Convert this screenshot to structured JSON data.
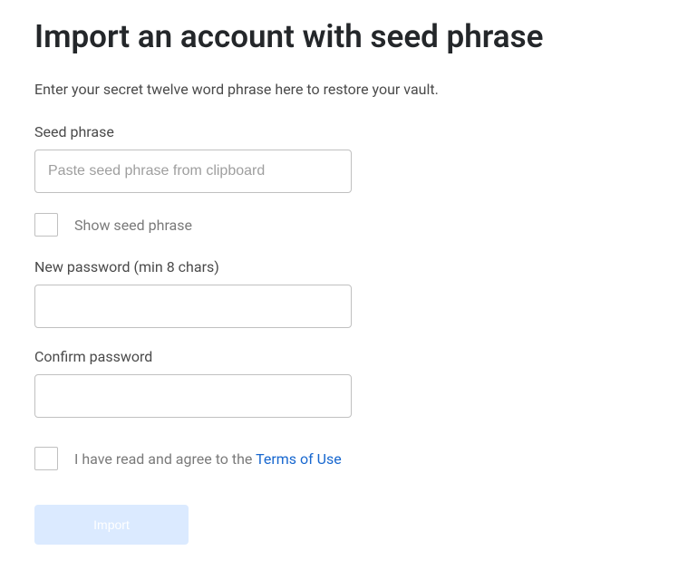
{
  "title": "Import an account with seed phrase",
  "subtitle": "Enter your secret twelve word phrase here to restore your vault.",
  "seed": {
    "label": "Seed phrase",
    "placeholder": "Paste seed phrase from clipboard",
    "value": "",
    "show_label": "Show seed phrase",
    "show_checked": false
  },
  "password": {
    "new_label": "New password (min 8 chars)",
    "new_value": "",
    "confirm_label": "Confirm password",
    "confirm_value": ""
  },
  "terms": {
    "text": "I have read and agree to the ",
    "link_text": "Terms of Use",
    "checked": false
  },
  "import_button": "Import"
}
